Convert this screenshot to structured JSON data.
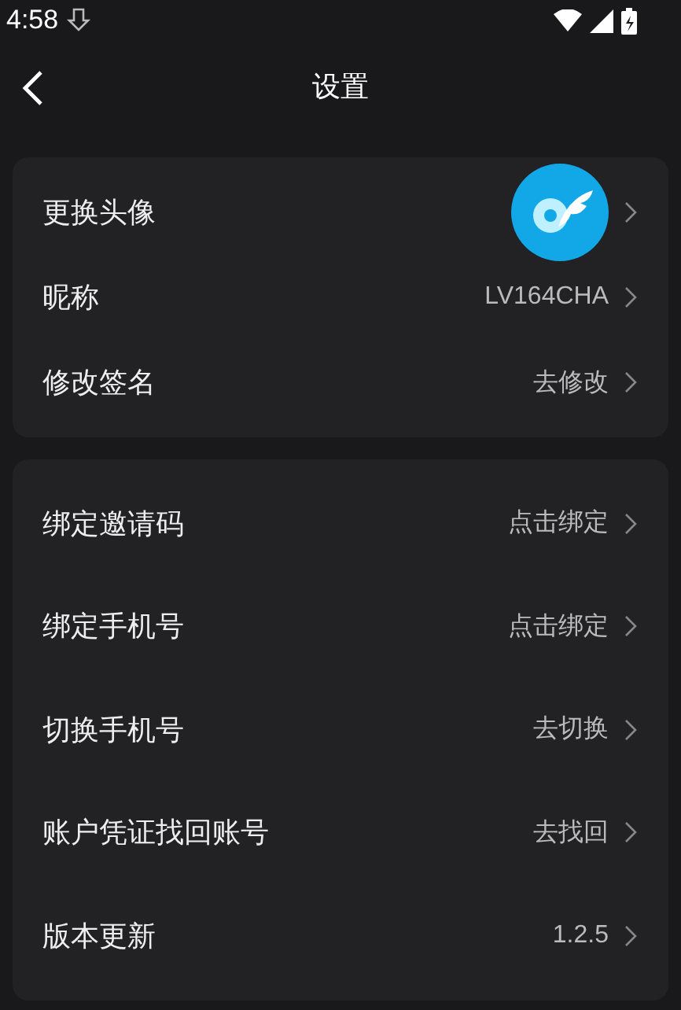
{
  "status_bar": {
    "time": "4:58"
  },
  "header": {
    "title": "设置"
  },
  "groups": [
    {
      "rows": [
        {
          "kind": "avatar",
          "label": "更换头像"
        },
        {
          "kind": "value",
          "label": "昵称",
          "value": "LV164CHA"
        },
        {
          "kind": "value",
          "label": "修改签名",
          "value": "去修改"
        }
      ]
    },
    {
      "rows": [
        {
          "kind": "value",
          "label": "绑定邀请码",
          "value": "点击绑定"
        },
        {
          "kind": "value",
          "label": "绑定手机号",
          "value": "点击绑定"
        },
        {
          "kind": "value",
          "label": "切换手机号",
          "value": "去切换"
        },
        {
          "kind": "value",
          "label": "账户凭证找回账号",
          "value": "去找回"
        },
        {
          "kind": "value",
          "label": "版本更新",
          "value": "1.2.5"
        }
      ]
    }
  ]
}
